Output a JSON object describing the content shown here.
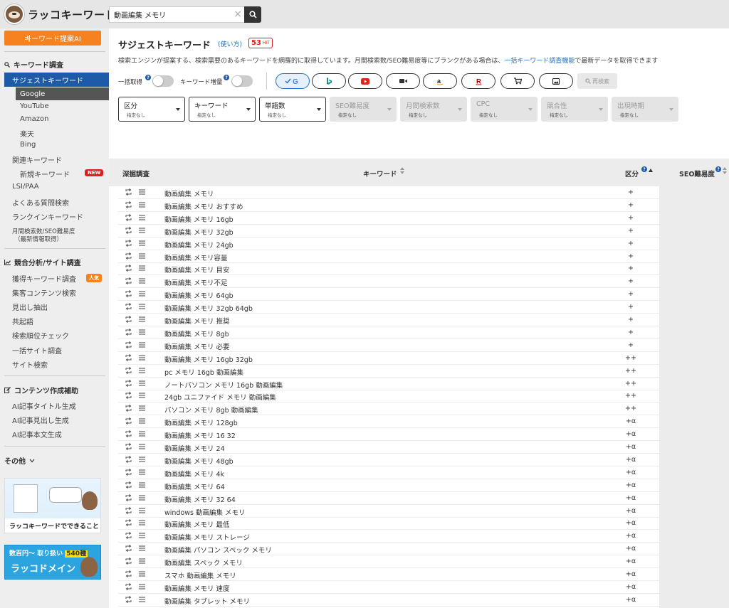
{
  "app": {
    "name": "ラッコキーワード"
  },
  "search": {
    "value": "動画編集 メモリ",
    "clear_icon": "×"
  },
  "sidebar": {
    "ai_button": "キーワード提案AI",
    "sections": {
      "keyword": "キーワード調査",
      "competitor": "競合分析/サイト調査",
      "content": "コンテンツ作成補助",
      "other": "その他"
    },
    "items": {
      "suggest": "サジェストキーワード",
      "google": "Google",
      "youtube": "YouTube",
      "amazon": "Amazon",
      "rakuten": "楽天",
      "bing": "Bing",
      "related": "関連キーワード",
      "new_keywords": "新規キーワード",
      "lsi": "LSI/PAA",
      "faq": "よくある質問検索",
      "rankin": "ランクインキーワード",
      "volume_line1": "月間検索数/SEO難易度",
      "volume_line2": "（最新情報取得）",
      "acquired": "獲得キーワード調査",
      "attract": "集客コンテンツ検索",
      "headings": "見出し抽出",
      "cooccur": "共起語",
      "rank_check": "検索順位チェック",
      "bulk_site": "一括サイト調査",
      "site_search": "サイト検索",
      "ai_title": "AI記事タイトル生成",
      "ai_heading": "AI記事見出し生成",
      "ai_body": "AI記事本文生成"
    },
    "badges": {
      "new": "NEW",
      "popular": "人気"
    },
    "banner1": {
      "caption": "ラッコキーワードでできること"
    },
    "banner2": {
      "top_text": "数百円〜 取り扱い",
      "count": "540種",
      "name": "ラッコドメイン"
    }
  },
  "header": {
    "title": "サジェストキーワード",
    "howto": "(使い方)",
    "hit_count": "53",
    "hit_label": "HIT",
    "desc_before": "検索エンジンが提案する、検索需要のあるキーワードを網羅的に取得しています。月間検索数/SEO難易度等にブランクがある場合は、",
    "desc_link": "一括キーワード調査機能",
    "desc_after": "で最新データを取得できます"
  },
  "toggles": {
    "bulk": "一括取得",
    "expand": "キーワード増量"
  },
  "engines": [
    "google",
    "bing",
    "youtube",
    "video",
    "amazon",
    "rakuten",
    "shopping",
    "image"
  ],
  "rescan_label": "再検索",
  "filters": [
    {
      "title": "区分",
      "value": "指定なし",
      "disabled": false
    },
    {
      "title": "キーワード",
      "value": "指定なし",
      "disabled": false
    },
    {
      "title": "単語数",
      "value": "指定なし",
      "disabled": false
    },
    {
      "title": "SEO難易度",
      "value": "指定なし",
      "disabled": true
    },
    {
      "title": "月間検索数",
      "value": "指定なし",
      "disabled": true
    },
    {
      "title": "CPC",
      "value": "指定なし",
      "disabled": true
    },
    {
      "title": "競合性",
      "value": "指定なし",
      "disabled": true
    },
    {
      "title": "出現時期",
      "value": "指定なし",
      "disabled": true
    }
  ],
  "table": {
    "columns": {
      "dig": "深掘調査",
      "keyword": "キーワード",
      "category": "区分",
      "seo": "SEO難易度"
    },
    "rows": [
      {
        "keyword": "動画編集 メモリ",
        "category": "+"
      },
      {
        "keyword": "動画編集 メモリ おすすめ",
        "category": "+"
      },
      {
        "keyword": "動画編集 メモリ 16gb",
        "category": "+"
      },
      {
        "keyword": "動画編集 メモリ 32gb",
        "category": "+"
      },
      {
        "keyword": "動画編集 メモリ 24gb",
        "category": "+"
      },
      {
        "keyword": "動画編集 メモリ容量",
        "category": "+"
      },
      {
        "keyword": "動画編集 メモリ 目安",
        "category": "+"
      },
      {
        "keyword": "動画編集 メモリ不足",
        "category": "+"
      },
      {
        "keyword": "動画編集 メモリ 64gb",
        "category": "+"
      },
      {
        "keyword": "動画編集 メモリ 32gb 64gb",
        "category": "+"
      },
      {
        "keyword": "動画編集 メモリ 推奨",
        "category": "+"
      },
      {
        "keyword": "動画編集 メモリ 8gb",
        "category": "+"
      },
      {
        "keyword": "動画編集 メモリ 必要",
        "category": "+"
      },
      {
        "keyword": "動画編集 メモリ 16gb 32gb",
        "category": "++"
      },
      {
        "keyword": "pc メモリ 16gb 動画編集",
        "category": "++"
      },
      {
        "keyword": "ノートパソコン メモリ 16gb 動画編集",
        "category": "++"
      },
      {
        "keyword": "24gb ユニファイド メモリ 動画編集",
        "category": "++"
      },
      {
        "keyword": "パソコン メモリ 8gb 動画編集",
        "category": "++"
      },
      {
        "keyword": "動画編集 メモリ 128gb",
        "category": "+α"
      },
      {
        "keyword": "動画編集 メモリ 16 32",
        "category": "+α"
      },
      {
        "keyword": "動画編集 メモリ 24",
        "category": "+α"
      },
      {
        "keyword": "動画編集 メモリ 48gb",
        "category": "+α"
      },
      {
        "keyword": "動画編集 メモリ 4k",
        "category": "+α"
      },
      {
        "keyword": "動画編集 メモリ 64",
        "category": "+α"
      },
      {
        "keyword": "動画編集 メモリ 32 64",
        "category": "+α"
      },
      {
        "keyword": "windows 動画編集 メモリ",
        "category": "+α"
      },
      {
        "keyword": "動画編集 メモリ 最低",
        "category": "+α"
      },
      {
        "keyword": "動画編集 メモリ ストレージ",
        "category": "+α"
      },
      {
        "keyword": "動画編集 パソコン スペック メモリ",
        "category": "+α"
      },
      {
        "keyword": "動画編集 スペック メモリ",
        "category": "+α"
      },
      {
        "keyword": "スマホ 動画編集 メモリ",
        "category": "+α"
      },
      {
        "keyword": "動画編集 メモリ 速度",
        "category": "+α"
      },
      {
        "keyword": "動画編集 タブレット メモリ",
        "category": "+α"
      }
    ]
  },
  "colors": {
    "accent_orange": "#f5821f",
    "nav_blue": "#1d5aa7",
    "hit_red": "#e02020",
    "link_blue": "#1d6fc6"
  }
}
